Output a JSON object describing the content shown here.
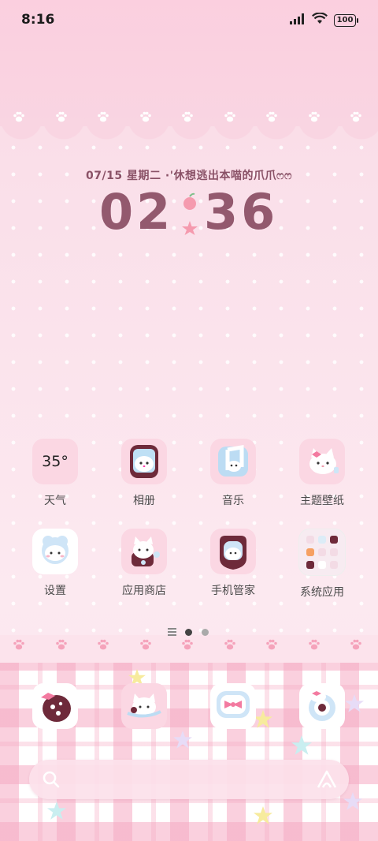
{
  "status_bar": {
    "time": "8:16",
    "battery": "100"
  },
  "widget": {
    "date_line": "07/15 星期二 ·'休想逃出本喵的爪爪ෆෆ",
    "hour": "02",
    "minute": "36"
  },
  "apps": [
    {
      "label": "天气",
      "icon": "weather-icon",
      "text": "35°"
    },
    {
      "label": "相册",
      "icon": "gallery-icon"
    },
    {
      "label": "音乐",
      "icon": "music-icon"
    },
    {
      "label": "主题壁纸",
      "icon": "themes-icon"
    },
    {
      "label": "设置",
      "icon": "settings-icon"
    },
    {
      "label": "应用商店",
      "icon": "app-store-icon"
    },
    {
      "label": "手机管家",
      "icon": "security-icon"
    },
    {
      "label": "系统应用",
      "icon": "folder-icon"
    }
  ],
  "pager": {
    "pages": 2,
    "current": 1
  },
  "dock": [
    {
      "icon": "phone-icon"
    },
    {
      "icon": "contacts-icon"
    },
    {
      "icon": "messages-icon"
    },
    {
      "icon": "browser-icon"
    }
  ],
  "search_bar": {
    "icons": [
      "search-icon",
      "assistant-icon"
    ]
  },
  "colors": {
    "accent": "#93596e",
    "background": "#fbe3ec",
    "icon_bg": "#fbd7e3"
  }
}
